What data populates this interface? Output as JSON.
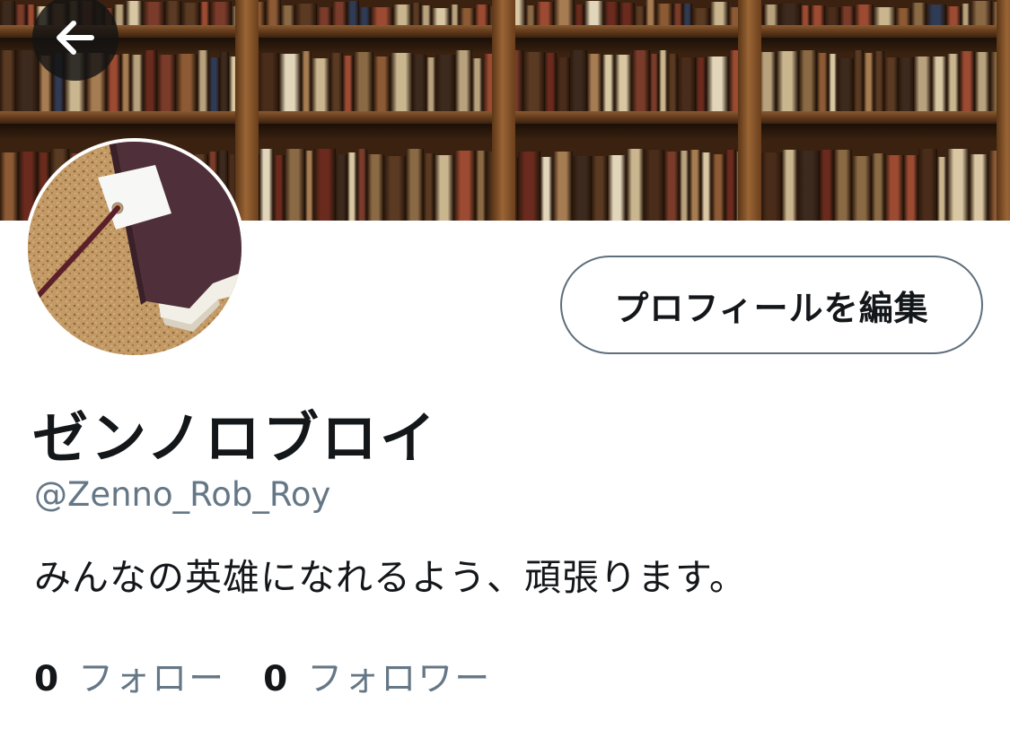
{
  "header": {
    "back_icon": "arrow-left-icon",
    "banner_image": "bookshelf-banner"
  },
  "profile": {
    "avatar_image": "book-on-cork-avatar",
    "display_name": "ゼンノロブロイ",
    "handle": "@Zenno_Rob_Roy",
    "bio": "みんなの英雄になれるよう、頑張ります。",
    "edit_button_label": "プロフィールを編集"
  },
  "stats": {
    "following_count": "0",
    "following_label": "フォロー",
    "followers_count": "0",
    "followers_label": "フォロワー"
  },
  "colors": {
    "primary_text": "#14171a",
    "secondary_text": "#657786",
    "button_border": "#5f6e7c",
    "background": "#ffffff"
  }
}
